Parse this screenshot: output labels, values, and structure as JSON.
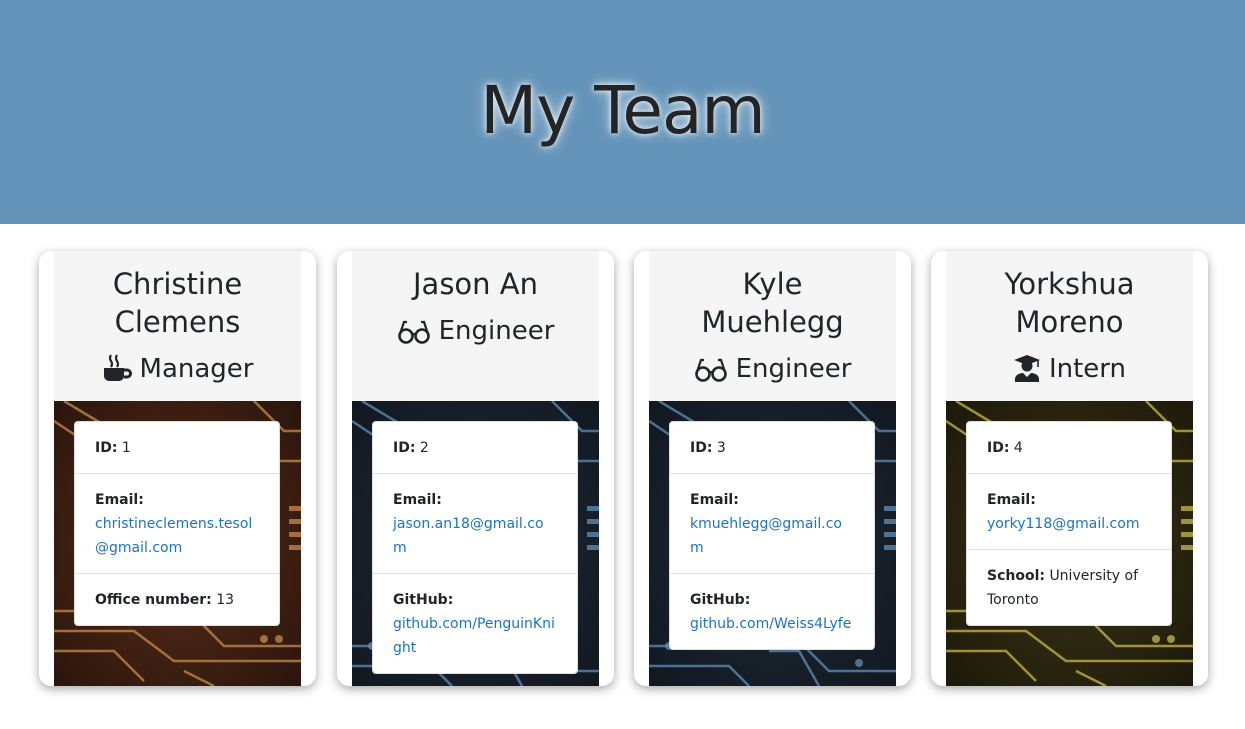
{
  "header": {
    "title": "My Team",
    "background": "#6393b8"
  },
  "employees": [
    {
      "name": "Christine Clemens",
      "role": "Manager",
      "role_icon": "coffee-mug-icon",
      "id_label": "ID:",
      "id": "1",
      "email_label": "Email:",
      "email": "christineclemens.tesol@gmail.com",
      "extra_label": "Office number:",
      "extra_value": "13",
      "accent": "#c98a4a"
    },
    {
      "name": "Jason An",
      "role": "Engineer",
      "role_icon": "glasses-icon",
      "id_label": "ID:",
      "id": "2",
      "email_label": "Email:",
      "email": "jason.an18@gmail.com",
      "extra_label": "GitHub:",
      "extra_value": "github.com/PenguinKnight",
      "accent": "#5f8fb8"
    },
    {
      "name": "Kyle Muehlegg",
      "role": "Engineer",
      "role_icon": "glasses-icon",
      "id_label": "ID:",
      "id": "3",
      "email_label": "Email:",
      "email": "kmuehlegg@gmail.com",
      "extra_label": "GitHub:",
      "extra_value": "github.com/Weiss4Lyfe",
      "accent": "#5f8fb8"
    },
    {
      "name": "Yorkshua Moreno",
      "role": "Intern",
      "role_icon": "graduate-icon",
      "id_label": "ID:",
      "id": "4",
      "email_label": "Email:",
      "email": "yorky118@gmail.com",
      "extra_label": "School:",
      "extra_value": "University of Toronto",
      "accent": "#c9b84a"
    }
  ]
}
